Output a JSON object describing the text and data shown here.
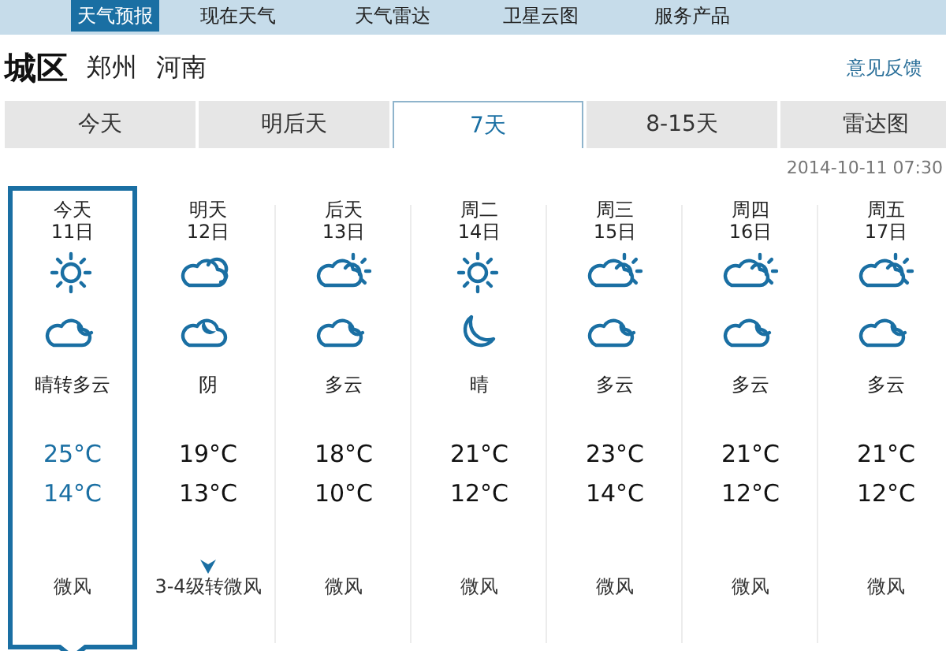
{
  "nav": [
    {
      "label": "天气预报",
      "selected": true
    },
    {
      "label": "现在天气",
      "selected": false
    },
    {
      "label": "天气雷达",
      "selected": false
    },
    {
      "label": "卫星云图",
      "selected": false
    },
    {
      "label": "服务产品",
      "selected": false
    }
  ],
  "location": {
    "district": "城区",
    "city": "郑州",
    "province": "河南"
  },
  "feedback_link": "意见反馈",
  "tabs": [
    {
      "label": "今天",
      "selected": false
    },
    {
      "label": "明后天",
      "selected": false
    },
    {
      "label": "7天",
      "selected": true
    },
    {
      "label": "8-15天",
      "selected": false
    },
    {
      "label": "雷达图",
      "selected": false
    }
  ],
  "updated": "2014-10-11 07:30",
  "days": [
    {
      "day": "今天",
      "date": "11日",
      "day_icon": {
        "kind": "sunny"
      },
      "night_icon": {
        "kind": "cloudmoon"
      },
      "weather": "晴转多云",
      "high": "25°C",
      "low": "14°C",
      "wind_change": false,
      "wind": "微风",
      "selected": true
    },
    {
      "day": "明天",
      "date": "12日",
      "day_icon": {
        "kind": "overcast"
      },
      "night_icon": {
        "kind": "moonbehind"
      },
      "weather": "阴",
      "high": "19°C",
      "low": "13°C",
      "wind_change": true,
      "wind": "3-4级转微风",
      "selected": false
    },
    {
      "day": "后天",
      "date": "13日",
      "day_icon": {
        "kind": "partly"
      },
      "night_icon": {
        "kind": "cloudmoon"
      },
      "weather": "多云",
      "high": "18°C",
      "low": "10°C",
      "wind_change": false,
      "wind": "微风",
      "selected": false
    },
    {
      "day": "周二",
      "date": "14日",
      "day_icon": {
        "kind": "sunny"
      },
      "night_icon": {
        "kind": "moon"
      },
      "weather": "晴",
      "high": "21°C",
      "low": "12°C",
      "wind_change": false,
      "wind": "微风",
      "selected": false
    },
    {
      "day": "周三",
      "date": "15日",
      "day_icon": {
        "kind": "partly"
      },
      "night_icon": {
        "kind": "cloudmoon"
      },
      "weather": "多云",
      "high": "23°C",
      "low": "14°C",
      "wind_change": false,
      "wind": "微风",
      "selected": false
    },
    {
      "day": "周四",
      "date": "16日",
      "day_icon": {
        "kind": "partly"
      },
      "night_icon": {
        "kind": "cloudmoon"
      },
      "weather": "多云",
      "high": "21°C",
      "low": "12°C",
      "wind_change": false,
      "wind": "微风",
      "selected": false
    },
    {
      "day": "周五",
      "date": "17日",
      "day_icon": {
        "kind": "partly"
      },
      "night_icon": {
        "kind": "cloudmoon"
      },
      "weather": "多云",
      "high": "21°C",
      "low": "12°C",
      "wind_change": false,
      "wind": "微风",
      "selected": false
    }
  ]
}
